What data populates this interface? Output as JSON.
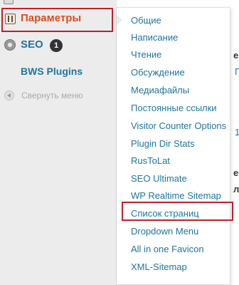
{
  "sidebar": {
    "parameters_label": "Параметры",
    "seo_label": "SEO",
    "seo_badge": "1",
    "bws_label": "BWS Plugins",
    "collapse_label": "Свернуть меню"
  },
  "submenu": {
    "items": [
      "Общие",
      "Написание",
      "Чтение",
      "Обсуждение",
      "Медиафайлы",
      "Постоянные ссылки",
      "Visitor Counter Options",
      "Plugin Dir Stats",
      "RusToLat",
      "SEO Ultimate",
      "WP Realtime Sitemap",
      "Список страниц",
      "Dropdown Menu",
      "All in one Favicon",
      "XML-Sitemap"
    ],
    "highlighted_item": "Dropdown Menu"
  },
  "colors": {
    "highlight_border": "#c11f2b",
    "link": "#21759b",
    "active_label": "#d54e21"
  }
}
